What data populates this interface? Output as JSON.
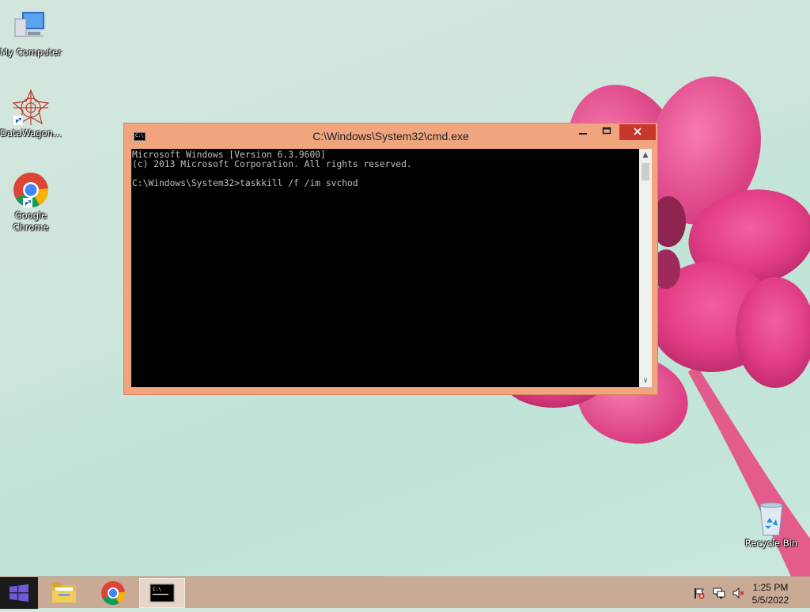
{
  "desktop": {
    "icons": [
      {
        "label": "My Computer"
      },
      {
        "label": "DataWagon..."
      },
      {
        "label": "Google Chrome"
      },
      {
        "label": "Recycle Bin"
      }
    ]
  },
  "cmd_window": {
    "title": "C:\\Windows\\System32\\cmd.exe",
    "console_lines": [
      "Microsoft Windows [Version 6.3.9600]",
      "(c) 2013 Microsoft Corporation. All rights reserved.",
      "",
      "C:\\Windows\\System32>taskkill /f /im svchod"
    ],
    "close_color": "#c7372c",
    "frame_color": "#f0a57e"
  },
  "taskbar": {
    "items": [
      {
        "icon": "start-icon"
      },
      {
        "icon": "file-explorer-icon"
      },
      {
        "icon": "chrome-icon"
      },
      {
        "icon": "cmd-icon",
        "active": true
      }
    ],
    "tray": {
      "icons": [
        "action-center-flag-icon",
        "network-icon",
        "volume-muted-icon"
      ],
      "time": "1:25 PM",
      "date": "5/5/2022"
    }
  }
}
